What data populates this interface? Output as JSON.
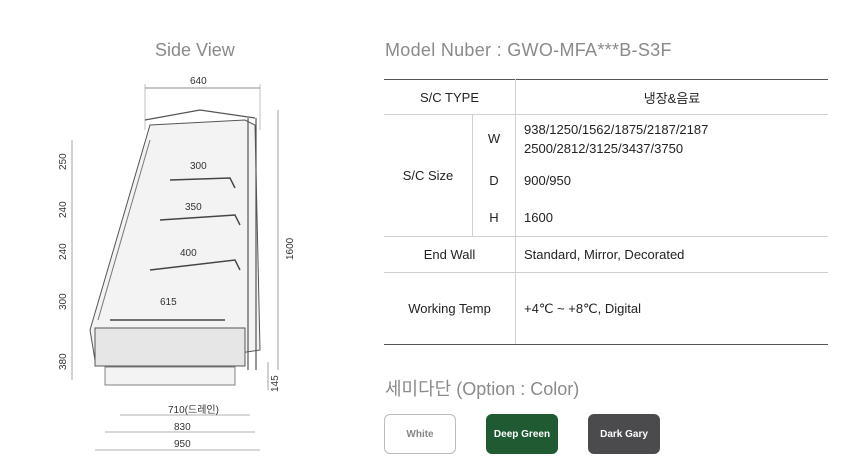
{
  "side_view_title": "Side View",
  "model_title": "Model Nuber : GWO-MFA***B-S3F",
  "diagram": {
    "top_width": "640",
    "shelf_depths": [
      "300",
      "350",
      "400",
      "615"
    ],
    "left_heights": [
      "250",
      "240",
      "240",
      "300",
      "380"
    ],
    "total_height": "1600",
    "base_height": "145",
    "bottom_widths": [
      "710(드레인)",
      "830",
      "950"
    ]
  },
  "table": {
    "sc_type_label": "S/C TYPE",
    "sc_type_value": "냉장&음료",
    "sc_size_label": "S/C Size",
    "w_label": "W",
    "w_value_line1": "938/1250/1562/1875/2187/2187",
    "w_value_line2": "2500/2812/3125/3437/3750",
    "d_label": "D",
    "d_value": "900/950",
    "h_label": "H",
    "h_value": "1600",
    "end_wall_label": "End Wall",
    "end_wall_value": "Standard, Mirror, Decorated",
    "working_temp_label": "Working Temp",
    "working_temp_value": "+4℃ ~ +8℃, Digital"
  },
  "option_title": "세미다단 (Option : Color)",
  "colors": [
    {
      "label": "White",
      "hex": "#ffffff"
    },
    {
      "label": "Deep Green",
      "hex": "#1f5a32"
    },
    {
      "label": "Dark Gary",
      "hex": "#4b4b4d"
    }
  ]
}
